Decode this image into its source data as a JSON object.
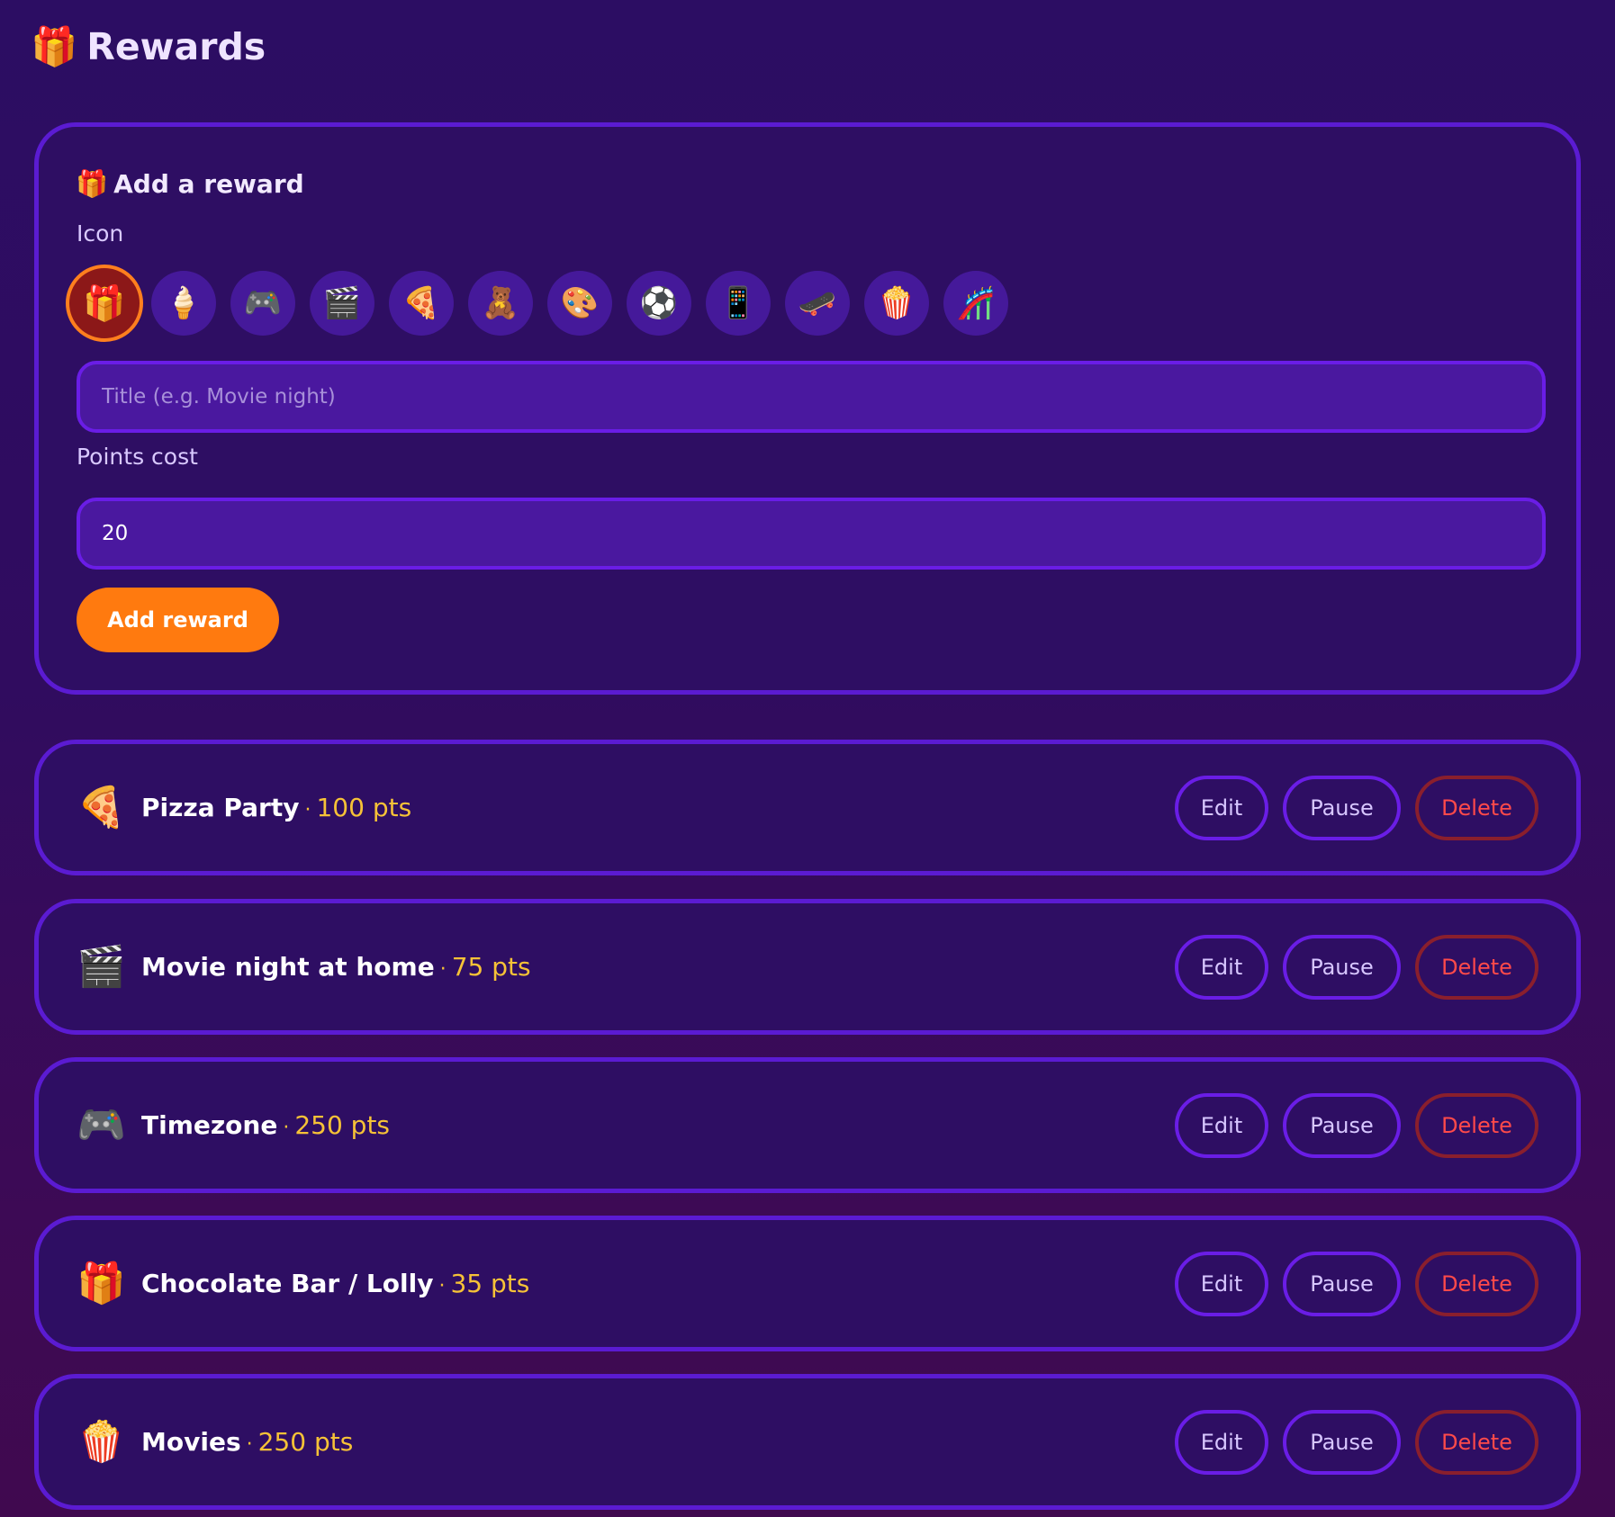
{
  "header": {
    "icon": "🎁",
    "title": "Rewards"
  },
  "add_form": {
    "heading_icon": "🎁",
    "heading": "Add a reward",
    "icon_label": "Icon",
    "icons": [
      "🎁",
      "🍦",
      "🎮",
      "🎬",
      "🍕",
      "🧸",
      "🎨",
      "⚽",
      "📱",
      "🛹",
      "🍿",
      "🎢"
    ],
    "selected_icon_index": 0,
    "title_placeholder": "Title (e.g. Movie night)",
    "title_value": "",
    "points_label": "Points cost",
    "points_value": "20",
    "submit_label": "Add reward"
  },
  "colors": {
    "accent": "#ff7a0f",
    "card_border": "#5b1bd2",
    "cost": "#f6c237",
    "delete": "#ff4a4a"
  },
  "rewards": [
    {
      "icon": "🍕",
      "title": "Pizza Party",
      "sep": "·",
      "cost": "100 pts",
      "edit": "Edit",
      "pause": "Pause",
      "delete": "Delete"
    },
    {
      "icon": "🎬",
      "title": "Movie night at home",
      "sep": "·",
      "cost": "75 pts",
      "edit": "Edit",
      "pause": "Pause",
      "delete": "Delete"
    },
    {
      "icon": "🎮",
      "title": "Timezone",
      "sep": "·",
      "cost": "250 pts",
      "edit": "Edit",
      "pause": "Pause",
      "delete": "Delete"
    },
    {
      "icon": "🎁",
      "title": "Chocolate Bar / Lolly",
      "sep": "·",
      "cost": "35 pts",
      "edit": "Edit",
      "pause": "Pause",
      "delete": "Delete"
    },
    {
      "icon": "🍿",
      "title": "Movies",
      "sep": "·",
      "cost": "250 pts",
      "edit": "Edit",
      "pause": "Pause",
      "delete": "Delete"
    }
  ]
}
